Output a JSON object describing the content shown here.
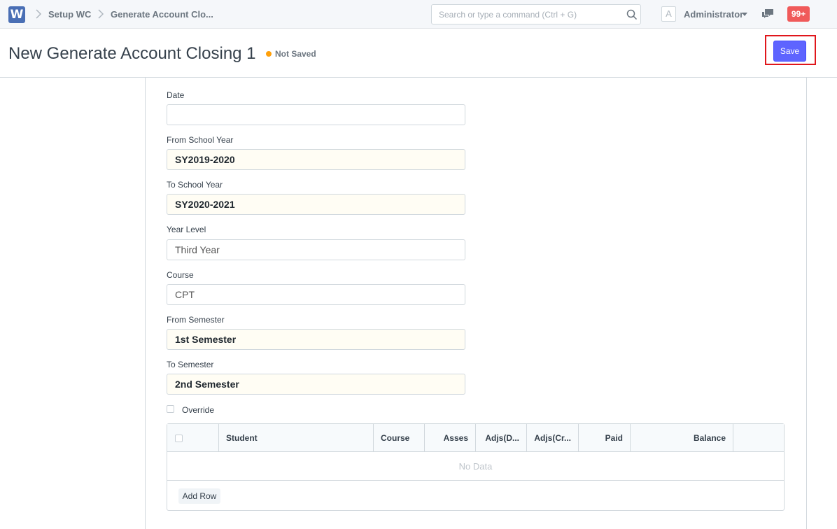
{
  "navbar": {
    "logo_letter": "W",
    "breadcrumbs": [
      "Setup WC",
      "Generate Account Clo..."
    ],
    "search_placeholder": "Search or type a command (Ctrl + G)",
    "avatar_letter": "A",
    "user_name": "Administrator",
    "notification_count": "99+"
  },
  "page": {
    "title": "New Generate Account Closing 1",
    "status": "Not Saved",
    "status_color": "#ffa00a",
    "save_label": "Save",
    "save_color": "#5e64ff"
  },
  "form": {
    "fields": [
      {
        "label": "Date",
        "value": ""
      },
      {
        "label": "From School Year",
        "value": "SY2019-2020"
      },
      {
        "label": "To School Year",
        "value": "SY2020-2021"
      },
      {
        "label": "Year Level",
        "value": "Third Year"
      },
      {
        "label": "Course",
        "value": "CPT"
      },
      {
        "label": "From Semester",
        "value": "1st Semester"
      },
      {
        "label": "To Semester",
        "value": "2nd Semester"
      }
    ],
    "override_label": "Override",
    "override_checked": false
  },
  "grid": {
    "columns": [
      "Student",
      "Course",
      "Asses",
      "Adjs(D...",
      "Adjs(Cr...",
      "Paid",
      "Balance"
    ],
    "empty_text": "No Data",
    "add_row_label": "Add Row"
  }
}
